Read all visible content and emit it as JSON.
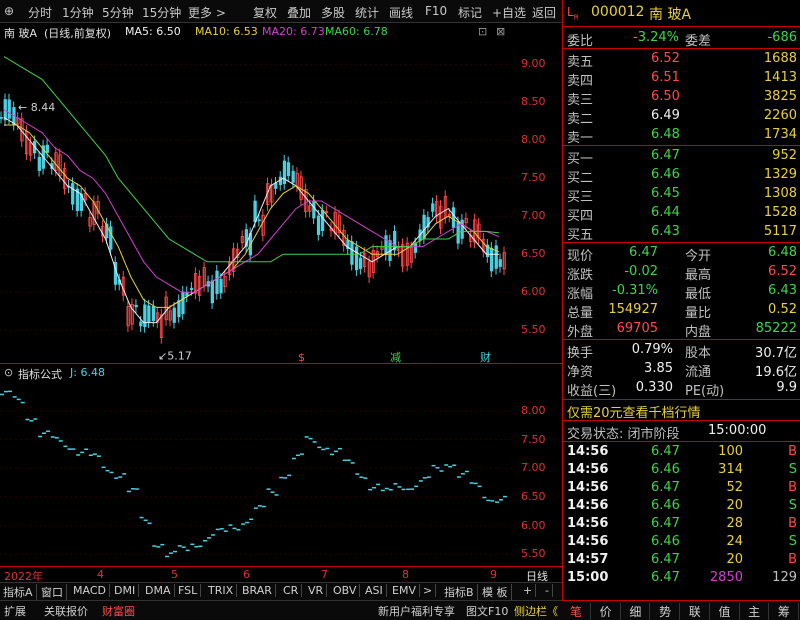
{
  "toolbar": {
    "items": [
      "分时",
      "1分钟",
      "5分钟",
      "15分钟",
      "更多 >",
      "复权",
      "叠加",
      "多股",
      "统计",
      "画线",
      "F10",
      "标记",
      "+自选",
      "返回"
    ]
  },
  "chart_header": {
    "stock": "南 玻A",
    "mode": "(日线,前复权)",
    "ma5_label": "MA5: 6.50",
    "ma10_label": "MA10: 6.53",
    "ma20_label": "MA20: 6.73",
    "ma60_label": "MA60: 6.78"
  },
  "main_annotations": {
    "high_label": "8.44",
    "low_label": "5.17",
    "markers": [
      "$",
      "减",
      "财"
    ]
  },
  "sub_header": {
    "title": "指标公式",
    "j_label": "J: 6.48"
  },
  "colors": {
    "ma5": "#f0f0f0",
    "ma10": "#e8d03c",
    "ma20": "#d040d0",
    "ma60": "#3fd34a",
    "up": "#ff4a4a",
    "down": "#4ad0e0",
    "j_series": "#4ad0e0"
  },
  "chart_data": [
    {
      "type": "candlestick",
      "title": "南 玻A (日线,前复权)",
      "ylim": [
        5.2,
        9.2
      ],
      "yticks": [
        "9.00",
        "8.50",
        "8.00",
        "7.50",
        "7.00",
        "6.50",
        "6.00",
        "5.50"
      ],
      "xticks": [
        "2022年",
        "4",
        "5",
        "6",
        "7",
        "8",
        "9"
      ],
      "series": [
        {
          "name": "MA5",
          "values": [
            8.3,
            8.2,
            8.0,
            7.8,
            7.6,
            7.4,
            7.3,
            7.0,
            6.7,
            6.2,
            5.8,
            5.6,
            5.6,
            5.8,
            5.9,
            6.0,
            6.1,
            6.2,
            6.4,
            6.6,
            7.0,
            7.4,
            7.5,
            7.4,
            7.2,
            7.0,
            6.8,
            6.6,
            6.5,
            6.4,
            6.5,
            6.6,
            6.6,
            6.8,
            7.0,
            7.1,
            6.9,
            6.7,
            6.5,
            6.5
          ]
        },
        {
          "name": "MA10",
          "values": [
            8.2,
            8.2,
            8.1,
            7.9,
            7.7,
            7.5,
            7.4,
            7.2,
            6.9,
            6.6,
            6.2,
            5.9,
            5.8,
            5.8,
            5.9,
            6.0,
            6.1,
            6.2,
            6.3,
            6.5,
            6.8,
            7.1,
            7.3,
            7.4,
            7.3,
            7.1,
            6.9,
            6.7,
            6.6,
            6.5,
            6.5,
            6.5,
            6.6,
            6.7,
            6.9,
            7.0,
            6.9,
            6.8,
            6.6,
            6.53
          ]
        },
        {
          "name": "MA20",
          "values": [
            8.4,
            8.3,
            8.2,
            8.1,
            7.9,
            7.8,
            7.6,
            7.5,
            7.3,
            7.0,
            6.7,
            6.4,
            6.2,
            6.1,
            6.0,
            6.0,
            6.1,
            6.2,
            6.3,
            6.4,
            6.5,
            6.7,
            6.9,
            7.1,
            7.2,
            7.2,
            7.1,
            7.0,
            6.9,
            6.8,
            6.7,
            6.6,
            6.6,
            6.6,
            6.7,
            6.8,
            6.9,
            6.8,
            6.8,
            6.73
          ]
        },
        {
          "name": "MA60",
          "values": [
            9.1,
            9.0,
            8.9,
            8.8,
            8.6,
            8.4,
            8.2,
            8.0,
            7.8,
            7.5,
            7.3,
            7.1,
            6.9,
            6.7,
            6.6,
            6.5,
            6.4,
            6.4,
            6.4,
            6.4,
            6.4,
            6.4,
            6.5,
            6.5,
            6.5,
            6.5,
            6.5,
            6.5,
            6.5,
            6.6,
            6.6,
            6.6,
            6.6,
            6.7,
            6.7,
            6.7,
            6.8,
            6.8,
            6.8,
            6.78
          ]
        }
      ]
    },
    {
      "type": "scatter",
      "title": "指标公式",
      "ylim": [
        5.4,
        8.4
      ],
      "yticks": [
        "8.00",
        "7.50",
        "7.00",
        "6.50",
        "6.00",
        "5.50"
      ],
      "series": [
        {
          "name": "J",
          "values": [
            8.3,
            8.2,
            7.9,
            7.6,
            7.5,
            7.4,
            7.3,
            7.2,
            7.0,
            6.9,
            6.6,
            6.1,
            5.7,
            5.5,
            5.6,
            5.7,
            5.8,
            5.9,
            6.0,
            6.1,
            6.3,
            6.6,
            6.9,
            7.2,
            7.5,
            7.4,
            7.3,
            7.1,
            6.9,
            6.7,
            6.6,
            6.7,
            6.7,
            6.8,
            7.0,
            7.1,
            6.9,
            6.7,
            6.5,
            6.48
          ]
        }
      ]
    }
  ],
  "x_axis": {
    "labels": [
      "2022年",
      "4",
      "5",
      "6",
      "7",
      "8",
      "9"
    ],
    "right_label": "日线"
  },
  "bottom_tabs": [
    "指标A",
    "窗口",
    "MACD",
    "DMI",
    "DMA",
    "FSL",
    "TRIX",
    "BRAR",
    "CR",
    "VR",
    "OBV",
    "ASI",
    "EMV",
    ">",
    "指标B",
    "模 板",
    "+",
    "-"
  ],
  "bottom_bar": {
    "left": [
      "扩展",
      "关联报价",
      "财富圈"
    ],
    "right": [
      "新用户福利专享",
      "图文F10",
      "侧边栏《"
    ]
  },
  "quote": {
    "code": "000012",
    "name": "南 玻A",
    "weibi_label": "委比",
    "weibi": "-3.24%",
    "weicha_label": "委差",
    "weicha": "-686",
    "asks": [
      {
        "label": "卖五",
        "price": "6.52",
        "vol": "1688"
      },
      {
        "label": "卖四",
        "price": "6.51",
        "vol": "1413"
      },
      {
        "label": "卖三",
        "price": "6.50",
        "vol": "3825"
      },
      {
        "label": "卖二",
        "price": "6.49",
        "vol": "2260"
      },
      {
        "label": "卖一",
        "price": "6.48",
        "vol": "1734"
      }
    ],
    "bids": [
      {
        "label": "买一",
        "price": "6.47",
        "vol": "952"
      },
      {
        "label": "买二",
        "price": "6.46",
        "vol": "1329"
      },
      {
        "label": "买三",
        "price": "6.45",
        "vol": "1308"
      },
      {
        "label": "买四",
        "price": "6.44",
        "vol": "1528"
      },
      {
        "label": "买五",
        "price": "6.43",
        "vol": "5117"
      }
    ],
    "stats": [
      {
        "l1": "现价",
        "v1": "6.47",
        "l2": "今开",
        "v2": "6.48"
      },
      {
        "l1": "涨跌",
        "v1": "-0.02",
        "l2": "最高",
        "v2": "6.52"
      },
      {
        "l1": "涨幅",
        "v1": "-0.31%",
        "l2": "最低",
        "v2": "6.43"
      },
      {
        "l1": "总量",
        "v1": "154927",
        "l2": "量比",
        "v2": "0.52"
      },
      {
        "l1": "外盘",
        "v1": "69705",
        "l2": "内盘",
        "v2": "85222"
      }
    ],
    "stats2": [
      {
        "l1": "换手",
        "v1": "0.79%",
        "l2": "股本",
        "v2": "30.7亿"
      },
      {
        "l1": "净资",
        "v1": "3.85",
        "l2": "流通",
        "v2": "19.6亿"
      },
      {
        "l1": "收益(三)",
        "v1": "0.330",
        "l2": "PE(动)",
        "v2": "9.9"
      }
    ],
    "promo": "仅需20元查看千档行情",
    "trade_status_label": "交易状态: 闭市阶段",
    "trade_status_time": "15:00:00",
    "ticks": [
      {
        "t": "14:56",
        "p": "6.47",
        "v": "100",
        "s": "B"
      },
      {
        "t": "14:56",
        "p": "6.46",
        "v": "314",
        "s": "S"
      },
      {
        "t": "14:56",
        "p": "6.47",
        "v": "52",
        "s": "B"
      },
      {
        "t": "14:56",
        "p": "6.46",
        "v": "20",
        "s": "S"
      },
      {
        "t": "14:56",
        "p": "6.47",
        "v": "28",
        "s": "B"
      },
      {
        "t": "14:56",
        "p": "6.46",
        "v": "24",
        "s": "S"
      },
      {
        "t": "14:57",
        "p": "6.47",
        "v": "20",
        "s": "B"
      },
      {
        "t": "15:00",
        "p": "6.47",
        "v": "2850",
        "s": "129"
      }
    ]
  },
  "right_tabs": [
    "笔",
    "价",
    "细",
    "势",
    "联",
    "值",
    "主",
    "筹"
  ]
}
